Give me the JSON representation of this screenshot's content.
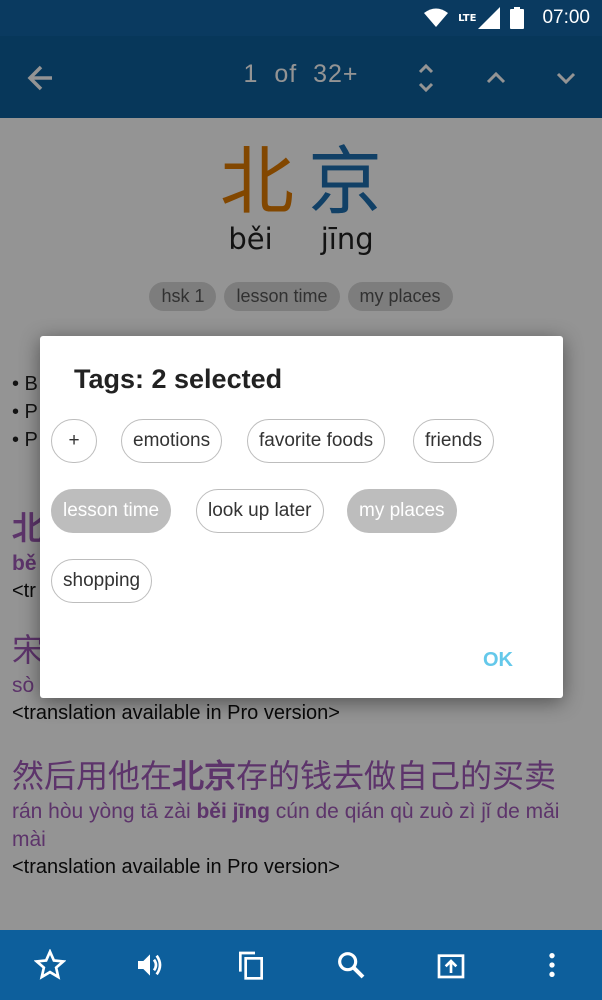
{
  "status_bar": {
    "network": "LTE",
    "time": "07:00"
  },
  "toolbar": {
    "current": "1",
    "of_label": "of",
    "total": "32+"
  },
  "word": {
    "hanzi": [
      "北",
      "京"
    ],
    "hanzi_colors": [
      "#e07a00",
      "#1e6fb0"
    ],
    "pinyin": [
      "běi",
      "jīng"
    ],
    "tags": [
      "hsk 1",
      "lesson time",
      "my places"
    ]
  },
  "definitions": [
    "• B",
    "• P",
    "• P"
  ],
  "examples": [
    {
      "hanzi_pre": "北",
      "pinyin": "bě",
      "translation": "<tr"
    },
    {
      "hanzi_pre": "宋",
      "pinyin": "sò",
      "translation": "<translation available in Pro version>"
    },
    {
      "hanzi_pre": "然后用他在",
      "hanzi_bold": "北京",
      "hanzi_post": "存的钱去做自己的买卖",
      "pinyin_pre": "rán hòu yòng tā zài ",
      "pinyin_bold": "běi jīng",
      "pinyin_post": " cún de qián qù zuò zì jǐ de mǎi mài",
      "translation": "<translation available in Pro version>"
    }
  ],
  "dialog": {
    "title": "Tags: 2 selected",
    "add_label": "+",
    "tags": [
      {
        "label": "emotions",
        "selected": false
      },
      {
        "label": "favorite foods",
        "selected": false
      },
      {
        "label": "friends",
        "selected": false
      },
      {
        "label": "lesson time",
        "selected": true
      },
      {
        "label": "look up later",
        "selected": false
      },
      {
        "label": "my places",
        "selected": true
      },
      {
        "label": "shopping",
        "selected": false
      }
    ],
    "ok_label": "OK"
  },
  "bottom_bar": [
    "star-icon",
    "speaker-icon",
    "copy-icon",
    "search-icon",
    "share-icon",
    "more-icon"
  ],
  "colors": {
    "primary": "#0d5f9c",
    "status": "#0a3a60",
    "accent_purple": "#a05ab8",
    "ok": "#64c8ea"
  }
}
